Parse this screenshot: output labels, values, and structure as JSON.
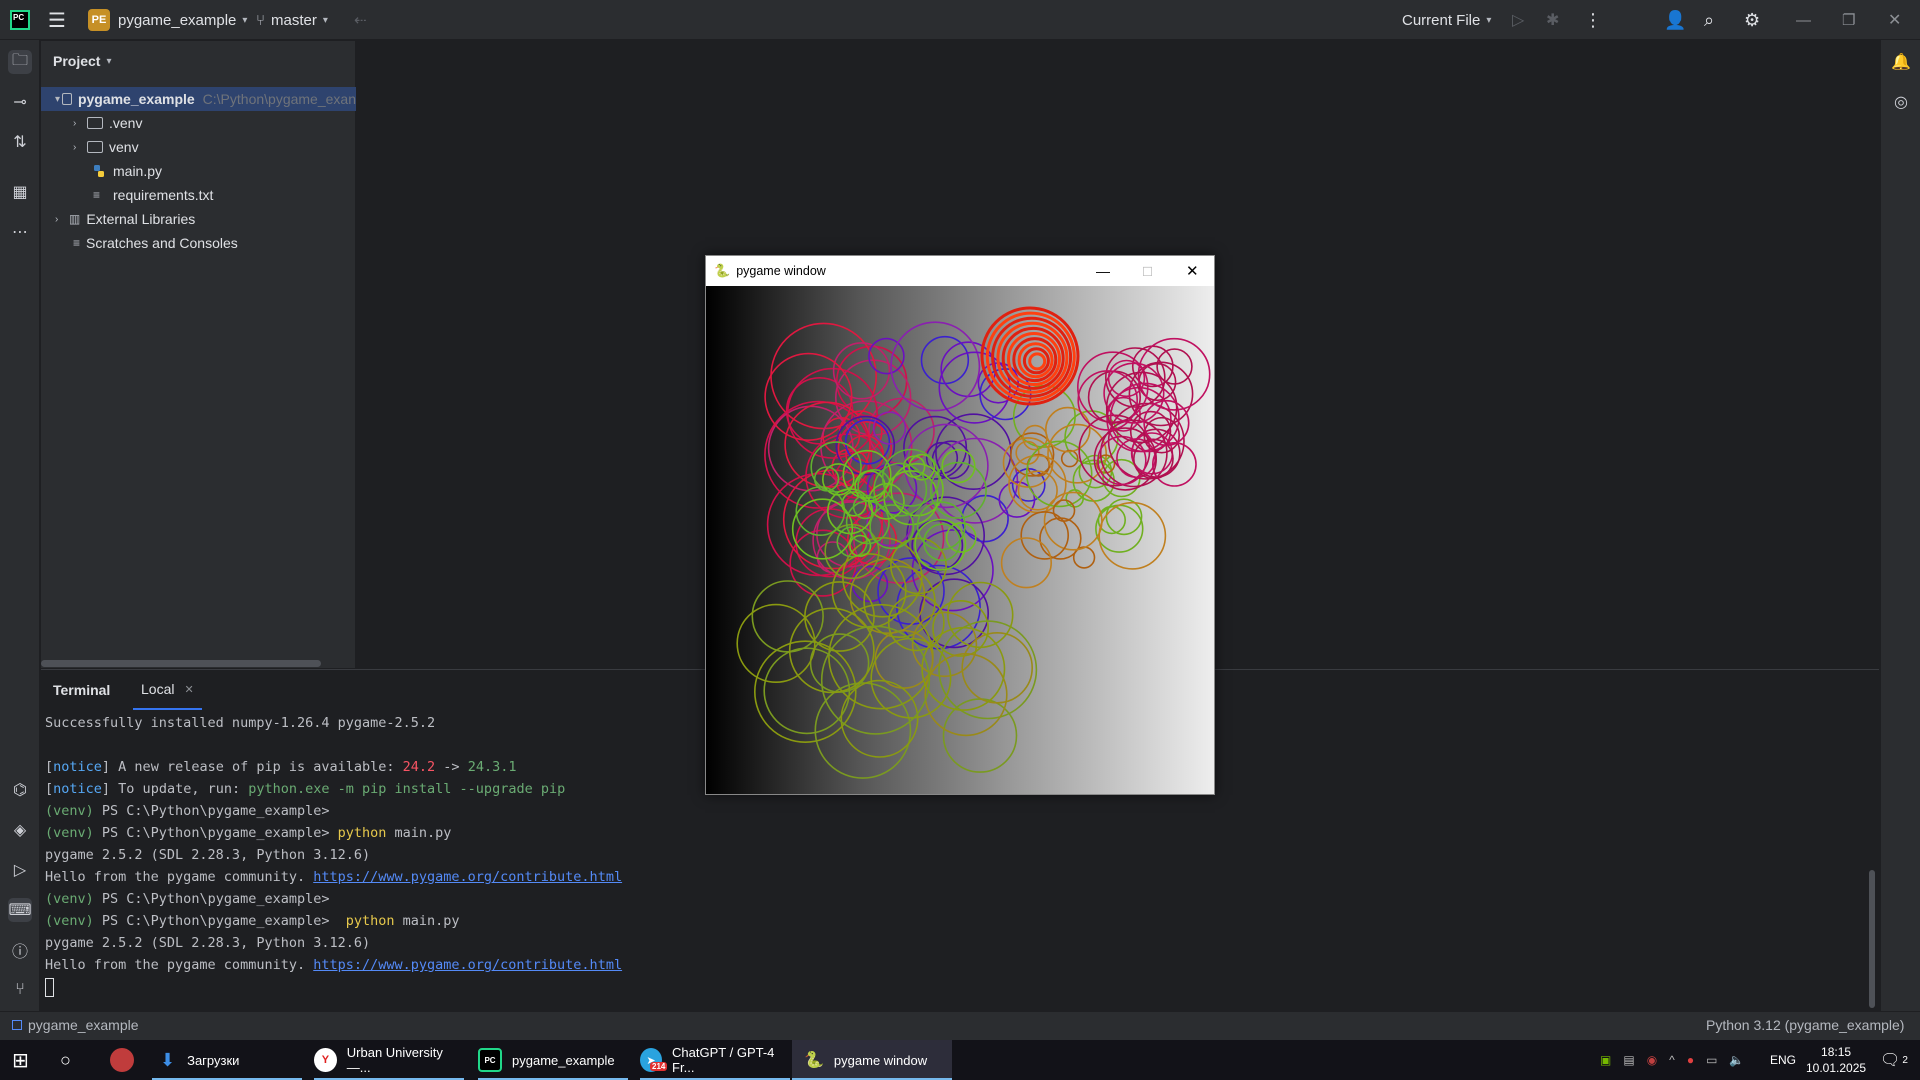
{
  "titlebar": {
    "project_badge": "PE",
    "project_name": "pygame_example",
    "branch": "master",
    "run_config": "Current File",
    "logo_text": "PC"
  },
  "project_panel": {
    "title": "Project",
    "root_name": "pygame_example",
    "root_path": "C:\\Python\\pygame_exan",
    "items": [
      {
        "label": ".venv",
        "type": "folder"
      },
      {
        "label": "venv",
        "type": "folder"
      },
      {
        "label": "main.py",
        "type": "python-file"
      },
      {
        "label": "requirements.txt",
        "type": "text-file"
      }
    ],
    "external_libraries": "External Libraries",
    "scratches": "Scratches and Consoles"
  },
  "terminal": {
    "tab_terminal": "Terminal",
    "tab_local": "Local",
    "lines": {
      "l1": "Successfully installed numpy-1.26.4 pygame-2.5.2",
      "l3_a": "[",
      "l3_notice": "notice",
      "l3_b": "] A new release of pip is available: ",
      "l3_old": "24.2",
      "l3_arrow": " -> ",
      "l3_new": "24.3.1",
      "l4_a": "[",
      "l4_notice": "notice",
      "l4_b": "] To update, run: ",
      "l4_cmd": "python.exe -m pip install --upgrade pip",
      "venv": "(venv)",
      "prompt": " PS C:\\Python\\pygame_example>",
      "cmd_python": " python",
      "cmd_main": " main.py",
      "cmd_python2": "  python",
      "pg_version": "pygame 2.5.2 (SDL 2.28.3, Python 3.12.6)",
      "hello": "Hello from the pygame community. ",
      "link": "https://www.pygame.org/contribute.html"
    }
  },
  "statusbar": {
    "project": "pygame_example",
    "interpreter": "Python 3.12 (pygame_example)"
  },
  "pygame_window": {
    "title": "pygame window"
  },
  "taskbar": {
    "items": [
      {
        "label": "Загрузки"
      },
      {
        "label": "Urban University —..."
      },
      {
        "label": "pygame_example"
      },
      {
        "label": "ChatGPT / GPT-4 Fr...",
        "badge": "214"
      },
      {
        "label": "pygame window"
      }
    ],
    "lang": "ENG",
    "time": "18:15",
    "date": "10.01.2025",
    "notif_count": "2"
  }
}
